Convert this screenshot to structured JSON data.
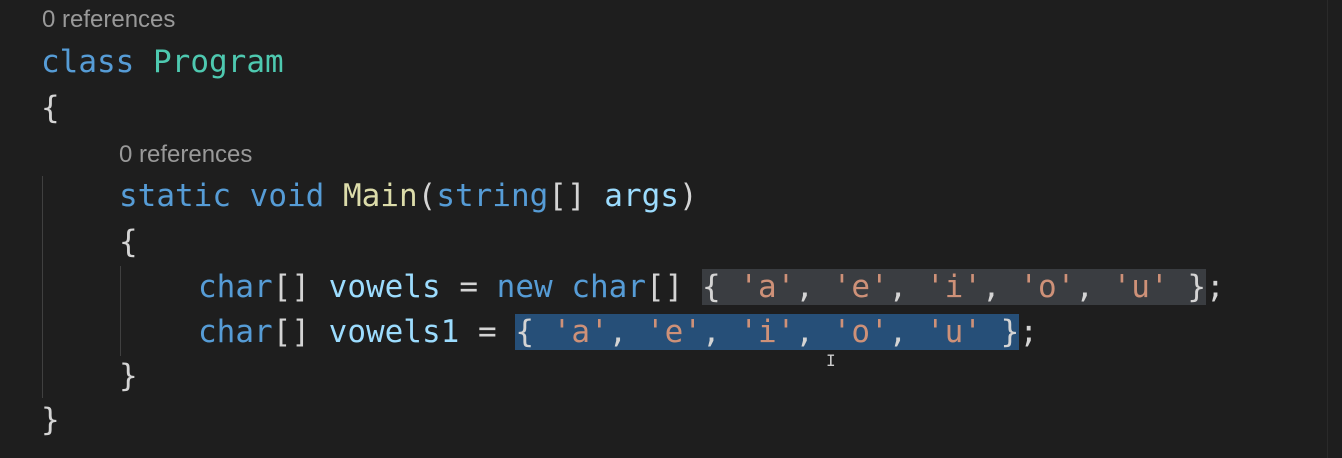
{
  "codelens": {
    "class_refs": "0 references",
    "method_refs": "0 references"
  },
  "code": {
    "line1": {
      "kw": "class",
      "name": "Program"
    },
    "line2": {
      "brace": "{"
    },
    "line3": {
      "kw1": "static",
      "kw2": "void",
      "fn": "Main",
      "open": "(",
      "type": "string",
      "arr": "[]",
      "param": "args",
      "close": ")"
    },
    "line4": {
      "brace": "{"
    },
    "line5": {
      "type1": "char",
      "arr1": "[]",
      "var": "vowels",
      "eq": "=",
      "new": "new",
      "type2": "char",
      "arr2": "[]",
      "open": "{",
      "items": [
        "'a'",
        "'e'",
        "'i'",
        "'o'",
        "'u'"
      ],
      "close": "}",
      "semi": ";"
    },
    "line6": {
      "type1": "char",
      "arr1": "[]",
      "var": "vowels1",
      "eq": "=",
      "open": "{",
      "items": [
        "'a'",
        "'e'",
        "'i'",
        "'o'",
        "'u'"
      ],
      "close": "}",
      "semi": ";"
    },
    "line7": {
      "brace": "}"
    },
    "line8": {
      "brace": "}"
    }
  },
  "colors": {
    "background": "#1e1e1e",
    "keyword": "#569cd6",
    "type": "#4ec9b0",
    "function": "#dcdcaa",
    "variable": "#9cdcfe",
    "string": "#ce9178",
    "selection": "#264f78",
    "highlight": "#3a3d41"
  }
}
